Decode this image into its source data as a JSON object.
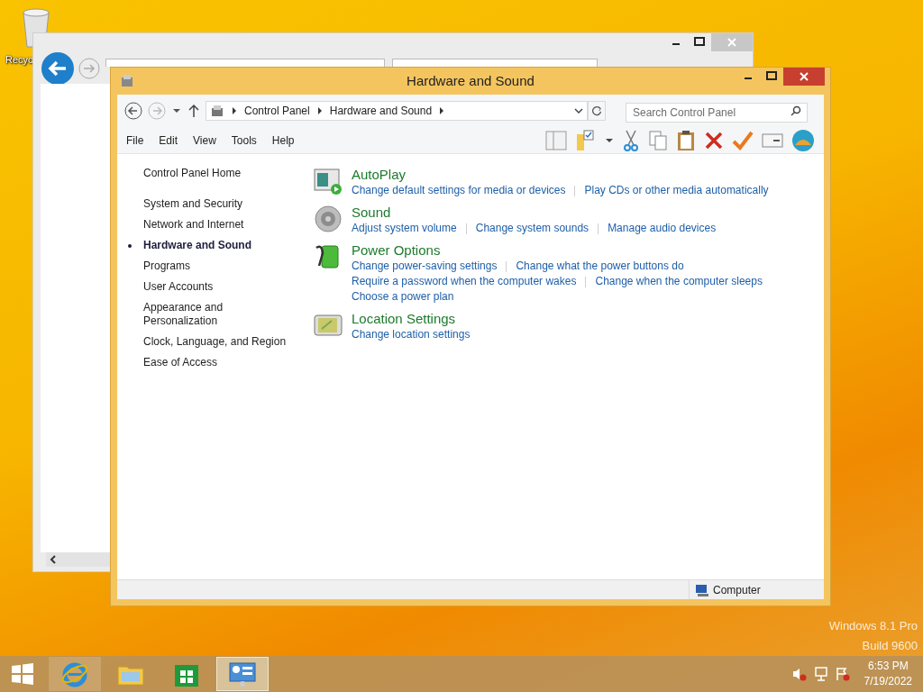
{
  "desktop": {
    "recycle_label": "Recyc",
    "os_lines": [
      "Windows 8.1 Pro",
      "Build 9600"
    ]
  },
  "window": {
    "title": "Hardware and Sound"
  },
  "address": {
    "crumbs": [
      "Control Panel",
      "Hardware and Sound"
    ],
    "search_placeholder": "Search Control Panel"
  },
  "menu": [
    "File",
    "Edit",
    "View",
    "Tools",
    "Help"
  ],
  "sidebar": {
    "home": "Control Panel Home",
    "items": [
      {
        "label": "System and Security",
        "selected": false
      },
      {
        "label": "Network and Internet",
        "selected": false
      },
      {
        "label": "Hardware and Sound",
        "selected": true
      },
      {
        "label": "Programs",
        "selected": false
      },
      {
        "label": "User Accounts",
        "selected": false
      },
      {
        "label": "Appearance and Personalization",
        "selected": false
      },
      {
        "label": "Clock, Language, and Region",
        "selected": false
      },
      {
        "label": "Ease of Access",
        "selected": false
      }
    ]
  },
  "categories": [
    {
      "kind": "autoplay",
      "title": "AutoPlay",
      "rows": [
        [
          "Change default settings for media or devices",
          "Play CDs or other media automatically"
        ]
      ]
    },
    {
      "kind": "sound",
      "title": "Sound",
      "rows": [
        [
          "Adjust system volume",
          "Change system sounds",
          "Manage audio devices"
        ]
      ]
    },
    {
      "kind": "power",
      "title": "Power Options",
      "rows": [
        [
          "Change power-saving settings",
          "Change what the power buttons do"
        ],
        [
          "Require a password when the computer wakes",
          "Change when the computer sleeps"
        ],
        [
          "Choose a power plan"
        ]
      ]
    },
    {
      "kind": "location",
      "title": "Location Settings",
      "rows": [
        [
          "Change location settings"
        ]
      ]
    }
  ],
  "status_bar": {
    "location": "Computer"
  },
  "taskbar": {
    "apps": [
      {
        "kind": "ie",
        "selected": false
      },
      {
        "kind": "explorer",
        "selected": false
      },
      {
        "kind": "store",
        "selected": false
      },
      {
        "kind": "control",
        "selected": true
      }
    ],
    "time": "6:53 PM",
    "date": "7/19/2022"
  }
}
